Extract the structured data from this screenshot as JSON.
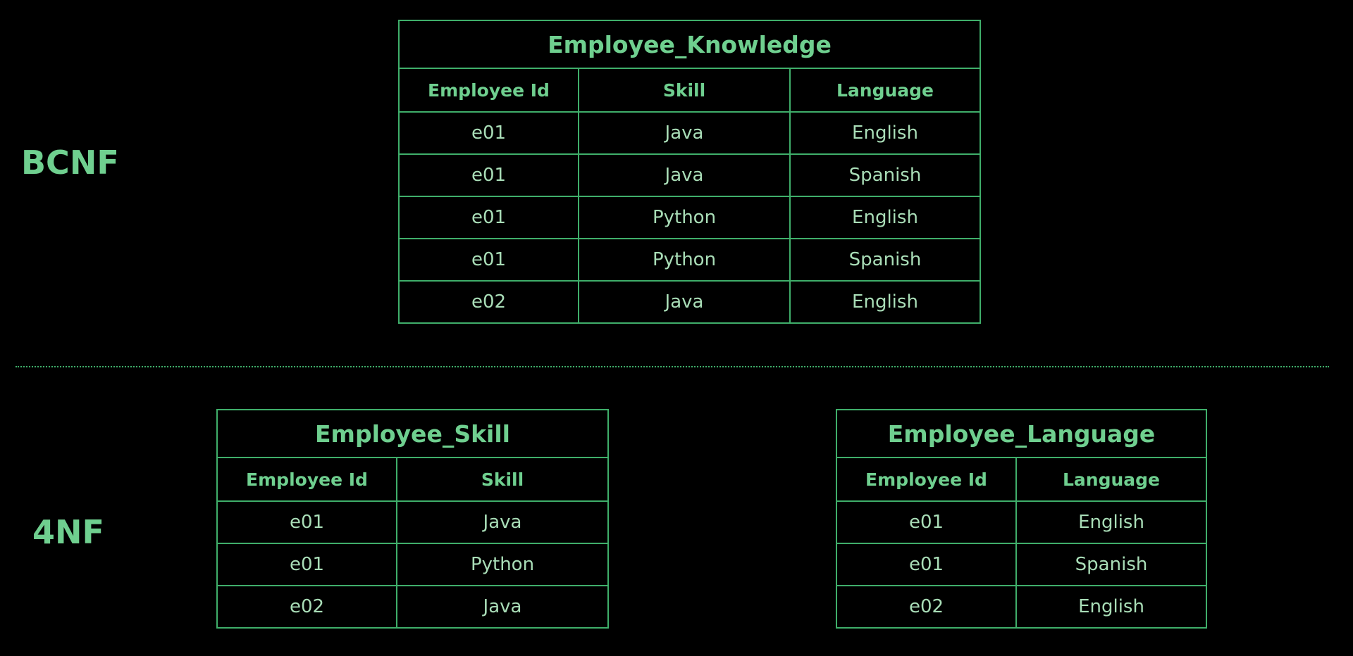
{
  "bcnf": {
    "label": "BCNF",
    "table": {
      "title": "Employee_Knowledge",
      "columns": [
        "Employee Id",
        "Skill",
        "Language"
      ],
      "rows": [
        [
          "e01",
          "Java",
          "English"
        ],
        [
          "e01",
          "Java",
          "Spanish"
        ],
        [
          "e01",
          "Python",
          "English"
        ],
        [
          "e01",
          "Python",
          "Spanish"
        ],
        [
          "e02",
          "Java",
          "English"
        ]
      ]
    }
  },
  "fourNF": {
    "label": "4NF",
    "skill_table": {
      "title": "Employee_Skill",
      "columns": [
        "Employee Id",
        "Skill"
      ],
      "rows": [
        [
          "e01",
          "Java"
        ],
        [
          "e01",
          "Python"
        ],
        [
          "e02",
          "Java"
        ]
      ]
    },
    "language_table": {
      "title": "Employee_Language",
      "columns": [
        "Employee Id",
        "Language"
      ],
      "rows": [
        [
          "e01",
          "English"
        ],
        [
          "e01",
          "Spanish"
        ],
        [
          "e02",
          "English"
        ]
      ]
    }
  },
  "colors": {
    "background": "#000000",
    "accent": "#6fcf8f",
    "border": "#3fae6a",
    "cell_text": "#a9ddb7"
  }
}
